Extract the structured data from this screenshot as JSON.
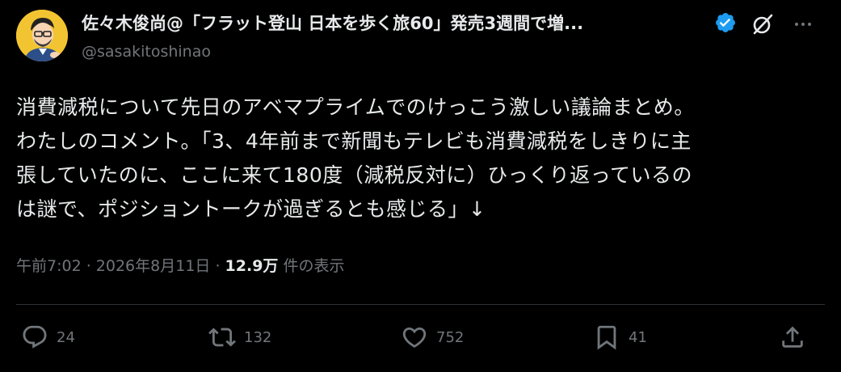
{
  "author": {
    "display_name": "佐々木俊尚@「フラット登山 日本を歩く旅60」発売3週間で増...",
    "handle": "@sasakitoshinao",
    "verified": true
  },
  "tweet": {
    "lines": [
      "消費減税について先日のアベマプライムでのけっこう激しい議論まとめ。",
      "わたしのコメント。「3、4年前まで新聞もテレビも消費減税をしきりに主",
      "張していたのに、ここに来て180度（減税反対に）ひっくり返っているの",
      "は謎で、ポジショントークが過ぎるとも感じる」↓"
    ]
  },
  "meta": {
    "time": "午前7:02",
    "separator": " · ",
    "date": "2026年8月11日",
    "views_count": "12.9万",
    "views_label": " 件の表示"
  },
  "actions": {
    "reply_count": "24",
    "retweet_count": "132",
    "like_count": "752",
    "bookmark_count": "41"
  },
  "colors": {
    "background": "#000000",
    "text": "#e7e9ea",
    "secondary": "#71767b",
    "verified": "#1d9bf0",
    "divider": "#2f3336"
  },
  "icons": {
    "verified": "verified-badge-icon",
    "grok": "grok-icon",
    "more": "more-dots-icon",
    "reply": "reply-icon",
    "retweet": "retweet-icon",
    "like": "heart-icon",
    "bookmark": "bookmark-icon",
    "share": "share-icon"
  }
}
